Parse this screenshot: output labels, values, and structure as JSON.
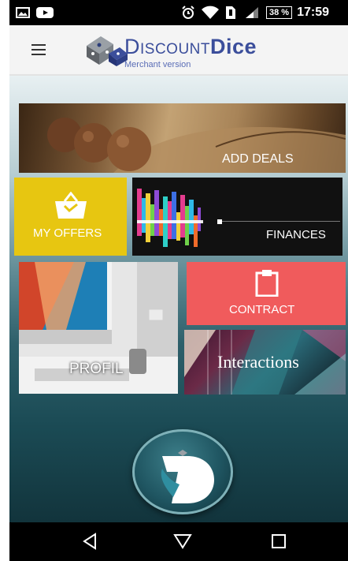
{
  "status_bar": {
    "battery": "38 %",
    "time": "17:59"
  },
  "app_bar": {
    "logo_main_prefix": "Discount",
    "logo_main_suffix": "Dice",
    "logo_sub": "Merchant version"
  },
  "tiles": {
    "add_deals": "ADD DEALS",
    "my_offers": "MY OFFERS",
    "finances": "FINANCES",
    "contract": "CONTRACT",
    "profil": "PROFIL",
    "interactions": "Interactions"
  },
  "colors": {
    "offers": "#e7c611",
    "contract": "#f05b5c",
    "brand": "#3b4e9b"
  },
  "icons": {
    "menu": "hamburger-icon",
    "basket": "basket-icon",
    "clipboard": "clipboard-icon",
    "back": "back-triangle-icon",
    "home": "home-icon",
    "recents": "recents-square-icon"
  }
}
